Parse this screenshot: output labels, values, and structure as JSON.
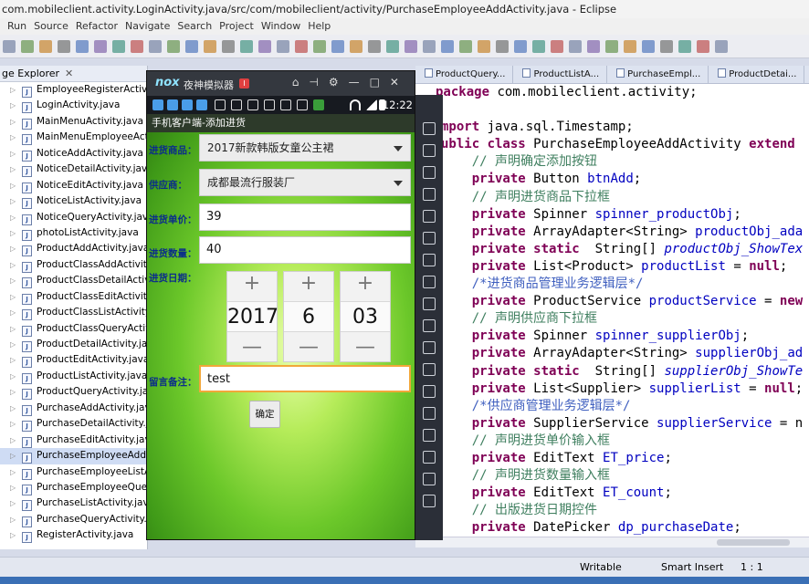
{
  "window": {
    "title": "com.mobileclient.activity.LoginActivity.java/src/com/mobileclient/activity/PurchaseEmployeeAddActivity.java - Eclipse"
  },
  "menu": [
    "Run",
    "Source",
    "Refactor",
    "Navigate",
    "Search",
    "Project",
    "Window",
    "Help"
  ],
  "explorer": {
    "title": "ge Explorer",
    "files": [
      "EmployeeRegisterActivi",
      "LoginActivity.java",
      "MainMenuActivity.java",
      "MainMenuEmployeeAct",
      "NoticeAddActivity.java",
      "NoticeDetailActivity.java",
      "NoticeEditActivity.java",
      "NoticeListActivity.java",
      "NoticeQueryActivity.java",
      "photoListActivity.java",
      "ProductAddActivity.java",
      "ProductClassAddActivity",
      "ProductClassDetailActiv",
      "ProductClassEditActivity",
      "ProductClassListActivity",
      "ProductClassQueryActiv",
      "ProductDetailActivity.java",
      "ProductEditActivity.java",
      "ProductListActivity.java",
      "ProductQueryActivity.java",
      "PurchaseAddActivity.java",
      "PurchaseDetailActivity.java",
      "PurchaseEditActivity.java",
      "PurchaseEmployeeAddA",
      "PurchaseEmployeeListA",
      "PurchaseEmployeeQuer",
      "PurchaseListActivity.java",
      "PurchaseQueryActivity.java",
      "RegisterActivity.java"
    ],
    "selected_index": 23
  },
  "editor_tabs": [
    "ProductQuery...",
    "ProductListA...",
    "PurchaseEmpl...",
    "ProductDetai..."
  ],
  "code_lines": [
    [
      [
        "kw",
        "package"
      ],
      [
        "t",
        " com.mobileclient.activity;"
      ]
    ],
    [
      [
        "t",
        ""
      ]
    ],
    [
      [
        "kw",
        "mport"
      ],
      [
        "t",
        " java.sql.Timestamp;"
      ]
    ],
    [
      [
        "kw",
        "ublic class"
      ],
      [
        "t",
        " PurchaseEmployeeAddActivity "
      ],
      [
        "kw",
        "extend"
      ]
    ],
    [
      [
        "t",
        "    "
      ],
      [
        "cm",
        "// 声明确定添加按钮"
      ]
    ],
    [
      [
        "t",
        "    "
      ],
      [
        "kw",
        "private"
      ],
      [
        "t",
        " Button "
      ],
      [
        "fld",
        "btnAdd"
      ],
      [
        "t",
        ";"
      ]
    ],
    [
      [
        "t",
        "    "
      ],
      [
        "cm",
        "// 声明进货商品下拉框"
      ]
    ],
    [
      [
        "t",
        "    "
      ],
      [
        "kw",
        "private"
      ],
      [
        "t",
        " Spinner "
      ],
      [
        "fld",
        "spinner_productObj"
      ],
      [
        "t",
        ";"
      ]
    ],
    [
      [
        "t",
        "    "
      ],
      [
        "kw",
        "private"
      ],
      [
        "t",
        " ArrayAdapter<String> "
      ],
      [
        "fld",
        "productObj_ada"
      ]
    ],
    [
      [
        "t",
        "    "
      ],
      [
        "kw",
        "private static"
      ],
      [
        "t",
        "  String[] "
      ],
      [
        "fldi",
        "productObj_ShowTex"
      ]
    ],
    [
      [
        "t",
        "    "
      ],
      [
        "kw",
        "private"
      ],
      [
        "t",
        " List<Product> "
      ],
      [
        "fld",
        "productList"
      ],
      [
        "t",
        " = "
      ],
      [
        "kw",
        "null"
      ],
      [
        "t",
        ";"
      ]
    ],
    [
      [
        "t",
        "    "
      ],
      [
        "cmb",
        "/*进货商品管理业务逻辑层*/"
      ]
    ],
    [
      [
        "t",
        "    "
      ],
      [
        "kw",
        "private"
      ],
      [
        "t",
        " ProductService "
      ],
      [
        "fld",
        "productService"
      ],
      [
        "t",
        " = "
      ],
      [
        "kw",
        "new"
      ]
    ],
    [
      [
        "t",
        "    "
      ],
      [
        "cm",
        "// 声明供应商下拉框"
      ]
    ],
    [
      [
        "t",
        "    "
      ],
      [
        "kw",
        "private"
      ],
      [
        "t",
        " Spinner "
      ],
      [
        "fld",
        "spinner_supplierObj"
      ],
      [
        "t",
        ";"
      ]
    ],
    [
      [
        "t",
        "    "
      ],
      [
        "kw",
        "private"
      ],
      [
        "t",
        " ArrayAdapter<String> "
      ],
      [
        "fld",
        "supplierObj_ad"
      ]
    ],
    [
      [
        "t",
        "    "
      ],
      [
        "kw",
        "private static"
      ],
      [
        "t",
        "  String[] "
      ],
      [
        "fldi",
        "supplierObj_ShowTe"
      ]
    ],
    [
      [
        "t",
        "    "
      ],
      [
        "kw",
        "private"
      ],
      [
        "t",
        " List<Supplier> "
      ],
      [
        "fld",
        "supplierList"
      ],
      [
        "t",
        " = "
      ],
      [
        "kw",
        "null"
      ],
      [
        "t",
        ";"
      ]
    ],
    [
      [
        "t",
        "    "
      ],
      [
        "cmb",
        "/*供应商管理业务逻辑层*/"
      ]
    ],
    [
      [
        "t",
        "    "
      ],
      [
        "kw",
        "private"
      ],
      [
        "t",
        " SupplierService "
      ],
      [
        "fld",
        "supplierService"
      ],
      [
        "t",
        " = n"
      ]
    ],
    [
      [
        "t",
        "    "
      ],
      [
        "cm",
        "// 声明进货单价输入框"
      ]
    ],
    [
      [
        "t",
        "    "
      ],
      [
        "kw",
        "private"
      ],
      [
        "t",
        " EditText "
      ],
      [
        "fld",
        "ET_price"
      ],
      [
        "t",
        ";"
      ]
    ],
    [
      [
        "t",
        "    "
      ],
      [
        "cm",
        "// 声明进货数量输入框"
      ]
    ],
    [
      [
        "t",
        "    "
      ],
      [
        "kw",
        "private"
      ],
      [
        "t",
        " EditText "
      ],
      [
        "fld",
        "ET_count"
      ],
      [
        "t",
        ";"
      ]
    ],
    [
      [
        "t",
        "    "
      ],
      [
        "cm",
        "// 出版进货日期控件"
      ]
    ],
    [
      [
        "t",
        "    "
      ],
      [
        "kw",
        "private"
      ],
      [
        "t",
        " DatePicker "
      ],
      [
        "fld",
        "dp_purchaseDate"
      ],
      [
        "t",
        ";"
      ]
    ]
  ],
  "status": {
    "writable": "Writable",
    "insert_mode": "Smart Insert",
    "position": "1 : 1"
  },
  "emulator": {
    "title": "夜神模拟器",
    "clock": "12:22",
    "app_title": "手机客户端-添加进货",
    "form": {
      "product_label": "进货商品：",
      "product_value": "2017新款韩版女童公主裙",
      "supplier_label": "供应商：",
      "supplier_value": "成都最流行服装厂",
      "price_label": "进货单价：",
      "price_value": "39",
      "count_label": "进货数量：",
      "count_value": "40",
      "date_label": "进货日期：",
      "year": "2017",
      "month": "6",
      "day": "03",
      "memo_label": "留言备注：",
      "memo_value": "test",
      "submit": "确定"
    }
  }
}
